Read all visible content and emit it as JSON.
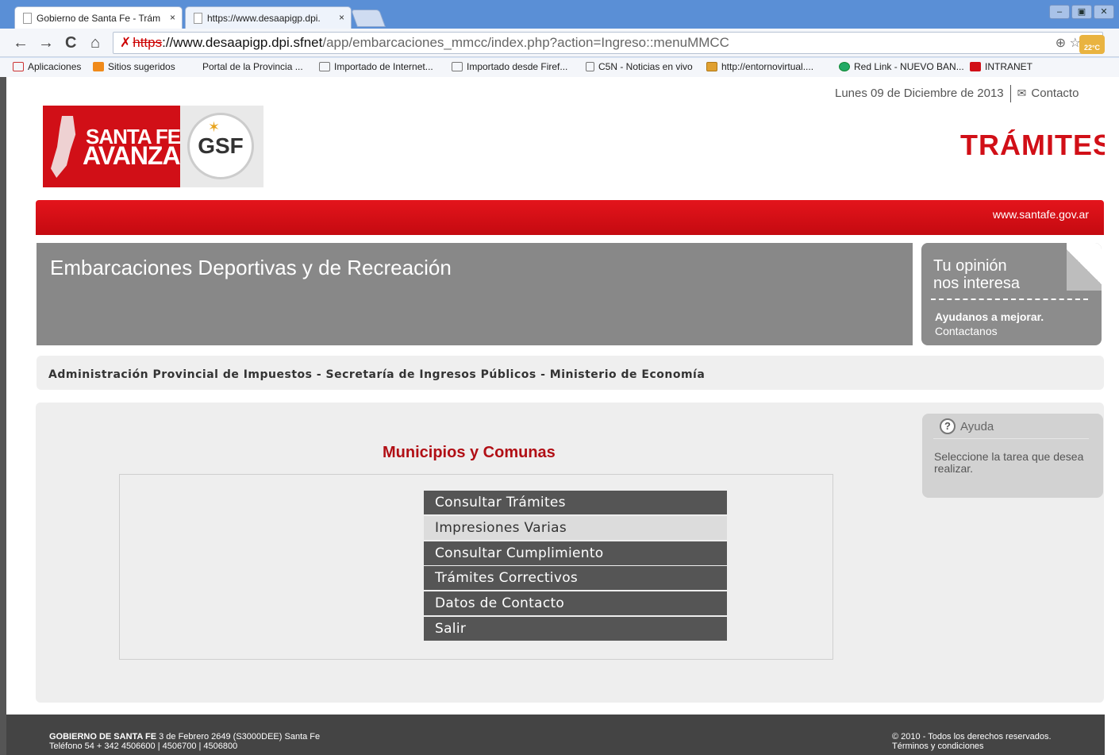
{
  "browser": {
    "tabs": [
      {
        "title": "Gobierno de Santa Fe - Trám",
        "close": "×"
      },
      {
        "title": "https://www.desaapigp.dpi.",
        "close": "×"
      }
    ],
    "nav": {
      "back": "←",
      "forward": "→",
      "reload": "C",
      "home": "⌂"
    },
    "url": {
      "scheme": "https",
      "host": "://www.desaapigp.dpi.sfnet",
      "path": "/app/embarcaciones_mmcc/index.php?action=Ingreso::menuMMCC"
    },
    "omni_icons": "⊕ ☆",
    "weather": "22°C",
    "bookmarks": [
      "Aplicaciones",
      "Sitios sugeridos",
      "Portal de la Provincia ...",
      "Importado de Internet...",
      "Importado desde Firef...",
      "C5N - Noticias en vivo",
      "http://entornovirtual....",
      "Red Link - NUEVO BAN...",
      "INTRANET"
    ],
    "window_buttons": [
      "‒",
      "▣",
      "✕"
    ]
  },
  "header": {
    "date": "Lunes 09 de Diciembre de 2013",
    "contact": "Contacto",
    "logo_line1": "SANTA FE",
    "logo_line2": "AVANZA",
    "gsf": "GSF",
    "tramites": "TRÁMITES",
    "site_url": "www.santafe.gov.ar"
  },
  "banner": {
    "title": "Embarcaciones Deportivas y de Recreación"
  },
  "opinion": {
    "line1": "Tu opinión",
    "line2": "nos interesa",
    "line3": "Ayudanos a mejorar.",
    "line4": "Contactanos"
  },
  "breadcrumb": "Administración Provincial de Impuestos - Secretaría de Ingresos Públicos - Ministerio de Economía",
  "main": {
    "title": "Municipios y Comunas",
    "menu": [
      "Consultar Trámites",
      "Impresiones Varias",
      "Consultar Cumplimiento",
      "Trámites Correctivos",
      "Datos de Contacto",
      "Salir"
    ]
  },
  "help": {
    "title": "Ayuda",
    "text": "Seleccione la tarea que desea realizar."
  },
  "footer": {
    "org": "GOBIERNO DE SANTA FE",
    "address": " 3 de Febrero 2649 (S3000DEE) Santa Fe",
    "phone": "Teléfono 54 + 342 4506600 | 4506700 | 4506800",
    "copyright": "© 2010 - Todos los derechos reservados.",
    "terms": "Términos y condiciones"
  }
}
